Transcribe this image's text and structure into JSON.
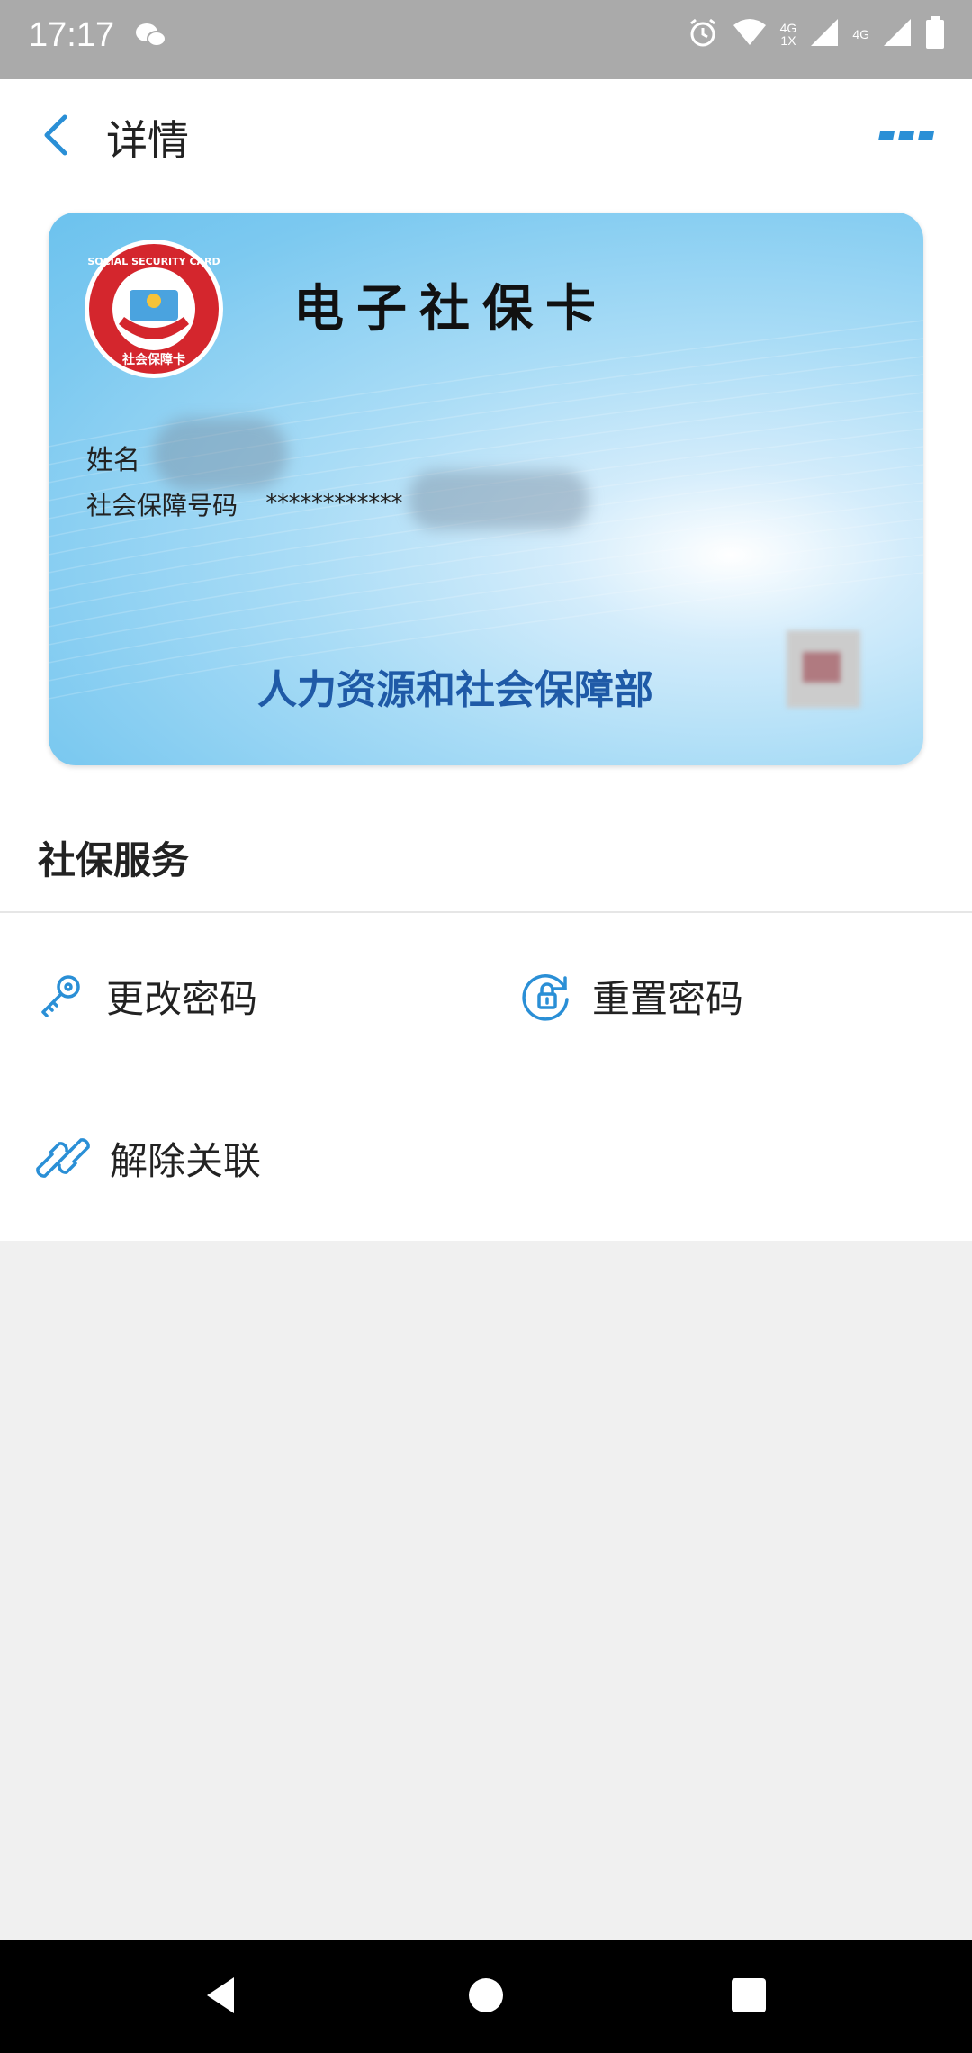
{
  "status_bar": {
    "time": "17:17",
    "network1_top": "4G",
    "network1_bottom": "1X",
    "network2": "4G"
  },
  "app_bar": {
    "title": "详情",
    "back_icon": "back-arrow-icon",
    "more_icon": "more-dots-icon"
  },
  "card": {
    "title": "电子社保卡",
    "name_label": "姓名",
    "ssn_label": "社会保障号码",
    "ssn_mask": "************",
    "issuer": "人力资源和社会保障部",
    "logo_text_top": "SOCIAL SECURITY CARD",
    "logo_text_bottom": "社会保障卡"
  },
  "services": {
    "section_title": "社保服务",
    "items": [
      {
        "label": "更改密码",
        "icon": "key-icon"
      },
      {
        "label": "重置密码",
        "icon": "lock-reset-icon"
      },
      {
        "label": "解除关联",
        "icon": "link-icon"
      }
    ]
  },
  "colors": {
    "accent": "#2a8fd6",
    "issuer_text": "#1f5aa7",
    "status_bar": "#aaaaaa"
  }
}
